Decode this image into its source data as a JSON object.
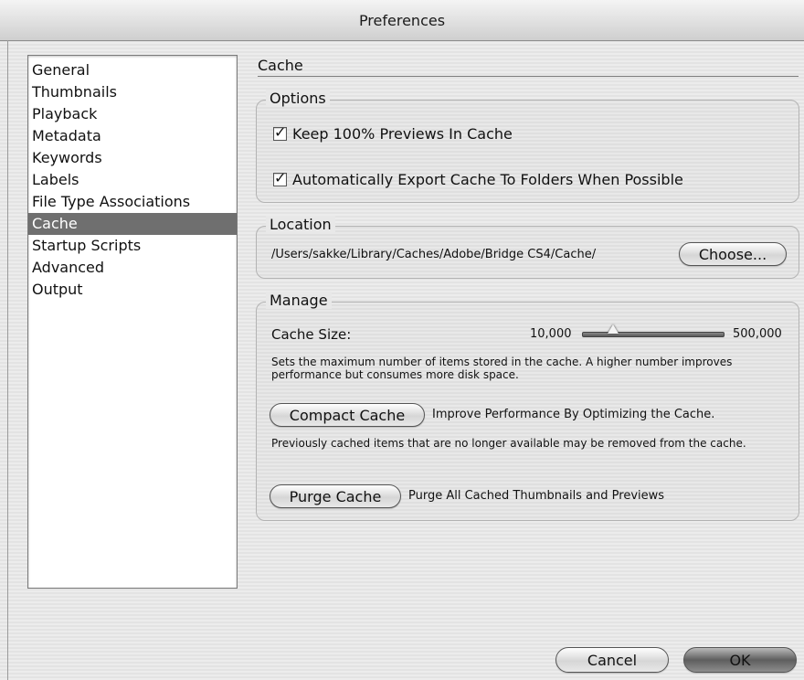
{
  "window": {
    "title": "Preferences"
  },
  "sidebar": {
    "selected_index": 7,
    "items": [
      {
        "label": "General"
      },
      {
        "label": "Thumbnails"
      },
      {
        "label": "Playback"
      },
      {
        "label": "Metadata"
      },
      {
        "label": "Keywords"
      },
      {
        "label": "Labels"
      },
      {
        "label": "File Type Associations"
      },
      {
        "label": "Cache"
      },
      {
        "label": "Startup Scripts"
      },
      {
        "label": "Advanced"
      },
      {
        "label": "Output"
      }
    ]
  },
  "panel": {
    "title": "Cache"
  },
  "options": {
    "legend": "Options",
    "keep_previews": {
      "label": "Keep 100% Previews In Cache",
      "checked": true
    },
    "auto_export": {
      "label": "Automatically Export Cache To Folders When Possible",
      "checked": true
    }
  },
  "location": {
    "legend": "Location",
    "path": "/Users/sakke/Library/Caches/Adobe/Bridge CS4/Cache/",
    "choose_label": "Choose..."
  },
  "manage": {
    "legend": "Manage",
    "cache_size_label": "Cache Size:",
    "slider_min_label": "10,000",
    "slider_max_label": "500,000",
    "slider_fraction": 0.22,
    "cache_size_help": "Sets the maximum number of items stored in the cache. A higher number improves performance but consumes more disk space.",
    "compact_label": "Compact Cache",
    "compact_desc": "Improve Performance By Optimizing the Cache.",
    "compact_help": "Previously cached items that are no longer available may be removed from the cache.",
    "purge_label": "Purge Cache",
    "purge_desc": "Purge All Cached Thumbnails and Previews"
  },
  "footer": {
    "cancel_label": "Cancel",
    "ok_label": "OK"
  }
}
